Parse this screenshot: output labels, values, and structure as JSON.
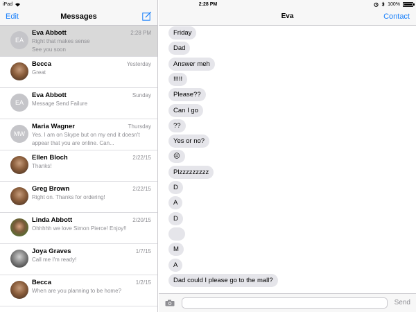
{
  "status": {
    "device": "iPad",
    "time": "2:28 PM",
    "battery": "100%",
    "battery_level": 1.0
  },
  "left": {
    "edit_label": "Edit",
    "title": "Messages",
    "conversations": [
      {
        "name": "Eva Abbott",
        "time": "2:28 PM",
        "preview": "Right that makes sense\nSee you soon",
        "initials": "EA",
        "selected": true
      },
      {
        "name": "Becca",
        "time": "Yesterday",
        "preview": "Great",
        "initials": ""
      },
      {
        "name": "Eva Abbott",
        "time": "Sunday",
        "preview": "Message Send Failure",
        "initials": "EA"
      },
      {
        "name": "Maria Wagner",
        "time": "Thursday",
        "preview": "Yes. I am on Skype but on my end it doesn't appear that you are online. Can...",
        "initials": "MW"
      },
      {
        "name": "Ellen Bloch",
        "time": "2/22/15",
        "preview": "Thanks!",
        "initials": ""
      },
      {
        "name": "Greg Brown",
        "time": "2/22/15",
        "preview": "Right on. Thanks for ordering!",
        "initials": ""
      },
      {
        "name": "Linda Abbott",
        "time": "2/20/15",
        "preview": "Ohhhhh we love Simon Pierce!  Enjoy!!",
        "initials": ""
      },
      {
        "name": "Joya Graves",
        "time": "1/7/15",
        "preview": "Call me I'm ready!",
        "initials": ""
      },
      {
        "name": "Becca",
        "time": "1/2/15",
        "preview": "When are you planning to be home?",
        "initials": ""
      }
    ]
  },
  "right": {
    "title": "Eva",
    "contact_label": "Contact",
    "messages": [
      {
        "text": "Friday"
      },
      {
        "text": "Dad"
      },
      {
        "text": "Answer meh"
      },
      {
        "text": "!!!!!"
      },
      {
        "text": "Please??"
      },
      {
        "text": "Can I go"
      },
      {
        "text": "??"
      },
      {
        "text": "Yes or no?"
      },
      {
        "text": "😒"
      },
      {
        "text": "Plzzzzzzzzz"
      },
      {
        "text": "D"
      },
      {
        "text": "A"
      },
      {
        "text": "D"
      },
      {
        "text": ""
      },
      {
        "text": "M"
      },
      {
        "text": "A"
      },
      {
        "text": "Dad could I please go to the mall?"
      }
    ],
    "input_placeholder": "",
    "send_label": "Send"
  }
}
